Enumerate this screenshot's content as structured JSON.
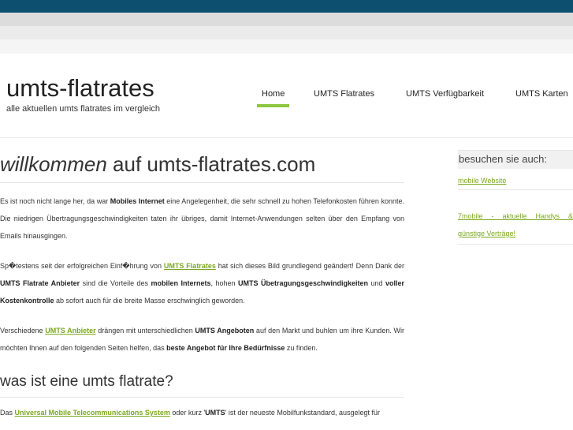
{
  "site": {
    "title": "umts-flatrates",
    "tagline": "alle aktuellen umts flatrates im vergleich"
  },
  "nav": {
    "items": [
      {
        "label": "Home",
        "active": true
      },
      {
        "label": "UMTS Flatrates"
      },
      {
        "label": "UMTS Verfügbarkeit"
      },
      {
        "label": "UMTS Karten"
      }
    ]
  },
  "main": {
    "heading_em": "willkommen",
    "heading_rest": " auf umts-flatrates.com",
    "p1": {
      "t1": "Es ist noch nicht lange her, da war ",
      "b1": "Mobiles Internet",
      "t2": " eine Angelegenheit, die sehr schnell zu hohen Telefonkosten führen konnte. Die niedrigen Übertragungsgeschwindigkeiten taten ihr übriges, damit Internet-Anwendungen selten über den Empfang von Emails hinausgingen."
    },
    "p2": {
      "t1": "Sp�testens seit der erfolgreichen Einf�hrung von ",
      "link": "UMTS Flatrates",
      "t2": " hat sich dieses Bild grundlegend geändert! Denn Dank der ",
      "b1": "UMTS Flatrate Anbieter",
      "t3": " sind die Vorteile des ",
      "b2": "mobilen Internets",
      "t4": ", hohen ",
      "b3": "UMTS Übetragungsgeschwindigkeiten",
      "t5": " und ",
      "b4": "voller Kostenkontrolle",
      "t6": " ab sofort auch für die breite Masse erschwinglich geworden."
    },
    "p3": {
      "t1": "Verschiedene ",
      "link": "UMTS Anbieter",
      "t2": " drängen mit unterschiedlichen ",
      "b1": "UMTS Angeboten",
      "t3": " auf den Markt und buhlen um ihre Kunden. Wir möchten Ihnen auf den folgenden Seiten helfen, das ",
      "b2": "beste Angebot für Ihre Bedürfnisse",
      "t4": " zu finden."
    },
    "heading2": "was ist eine umts flatrate?",
    "p4": {
      "t1": "Das ",
      "link": "Universal Mobile Telecommunications System",
      "t2": " oder kurz '",
      "b1": "UMTS",
      "t3": "' ist der neueste Mobilfunkstandard, ausgelegt für"
    }
  },
  "sidebar": {
    "heading": "besuchen sie auch:",
    "link1": "mobile Website",
    "link2": "7mobile - aktuelle Handys & günstige Verträge!"
  },
  "colors": {
    "topbar": "#0c4f6e",
    "accent": "#8dc63f",
    "link": "#7aa81e"
  }
}
